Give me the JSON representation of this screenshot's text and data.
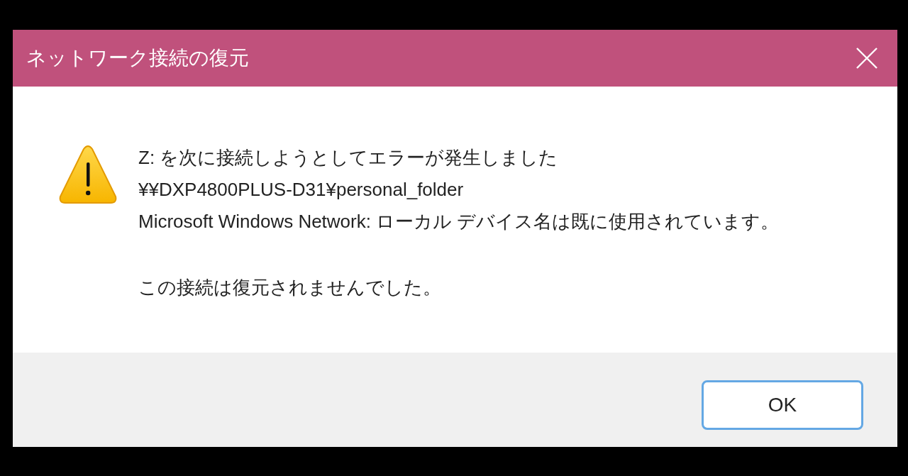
{
  "window": {
    "title": "ネットワーク接続の復元"
  },
  "message": {
    "lines": [
      "Z: を次に接続しようとしてエラーが発生しました",
      "¥¥DXP4800PLUS-D31¥personal_folder",
      "Microsoft Windows Network: ローカル デバイス名は既に使用されています。"
    ],
    "note": "この接続は復元されませんでした。"
  },
  "buttons": [
    {
      "label": "OK",
      "focused": true
    }
  ]
}
